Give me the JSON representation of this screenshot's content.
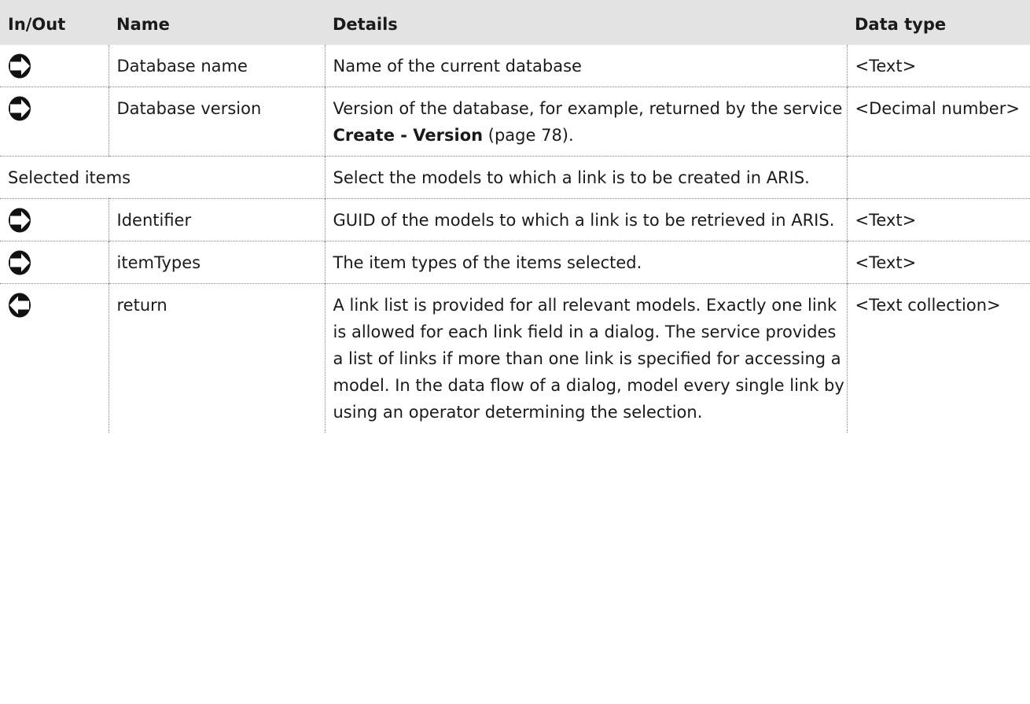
{
  "headers": {
    "in_out": "In/Out",
    "name": "Name",
    "details": "Details",
    "data_type": "Data type"
  },
  "rows": [
    {
      "direction": "input-arrow-icon",
      "name": "Database name",
      "details": "Name of the current database",
      "type": "<Text>"
    },
    {
      "direction": "input-arrow-icon",
      "name": "Database version",
      "details_pre": "Version of the database, for example, returned by the service ",
      "details_link": "Create - Version",
      "details_post": " (page 78).",
      "type": "<Decimal number>"
    },
    {
      "name": "Selected items",
      "details": "Select the models to which a link is to be created in ARIS.",
      "type": ""
    },
    {
      "direction": "input-arrow-icon",
      "name": "Identifier",
      "details": "GUID of the models to which a link is to be retrieved in ARIS.",
      "type": "<Text>"
    },
    {
      "direction": "input-arrow-icon",
      "name": "itemTypes",
      "details": "The item types of the items selected.",
      "type": "<Text>"
    },
    {
      "direction": "output-arrow-icon",
      "name": "return",
      "details": "A link list is provided for all relevant models. Exactly one link is allowed for each link field in a dialog. The service provides a list of links if more than one link is specified for accessing a model. In the data flow of a dialog, model every single link by using an operator determining the selection.",
      "type": "<Text collection>"
    }
  ]
}
